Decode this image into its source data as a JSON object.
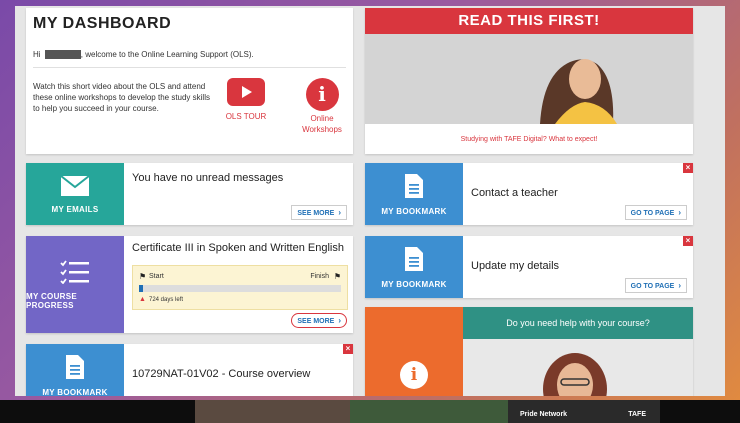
{
  "dashboard": {
    "title": "MY DASHBOARD",
    "greeting_prefix": "Hi",
    "greeting_suffix": ", welcome to the Online Learning Support (OLS).",
    "intro": "Watch this short video about the OLS and attend these online workshops to develop the study skills to help you succeed in your course.",
    "ols_tour_label": "OLS TOUR",
    "workshops_label": "Online Workshops"
  },
  "read_first": {
    "title": "READ THIS FIRST!",
    "caption": "Studying with TAFE Digital? What to expect!"
  },
  "emails": {
    "tile_label": "MY EMAILS",
    "message": "You have no unread messages",
    "see_more": "SEE MORE"
  },
  "bookmark_contact": {
    "tile_label": "MY BOOKMARK",
    "title": "Contact a teacher",
    "go_to": "GO TO PAGE"
  },
  "progress": {
    "tile_label": "MY COURSE PROGRESS",
    "course": "Certificate III in Spoken and Written English",
    "start": "Start",
    "finish": "Finish",
    "days_left": "724 days left",
    "progress_fraction": 0.01,
    "see_more": "SEE MORE"
  },
  "bookmark_details": {
    "tile_label": "MY BOOKMARK",
    "title": "Update my details",
    "go_to": "GO TO PAGE"
  },
  "bookmark_course": {
    "tile_label": "MY BOOKMARK",
    "title": "10729NAT-01V02 - Course overview"
  },
  "help": {
    "title": "Do you need help with your course?"
  },
  "video_strip": {
    "label": "Pride Network",
    "brand": "TAFE"
  },
  "colors": {
    "red": "#d9363e",
    "teal": "#26a69a",
    "blue": "#3d8fd1",
    "purple": "#7266c6",
    "orange": "#ec6b2d",
    "help_teal": "#2f9184"
  }
}
